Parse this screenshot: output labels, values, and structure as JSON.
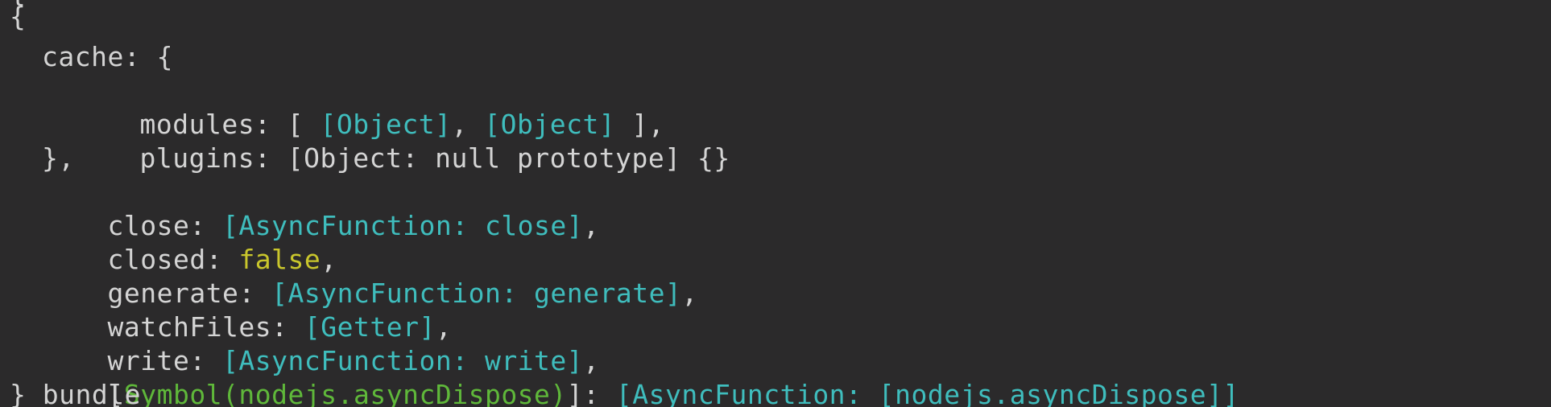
{
  "terminal": {
    "colors": {
      "background": "#2b2a2b",
      "text": "#d4d4d4",
      "special": "#3fbdbd",
      "boolean": "#c9c62c",
      "symbol": "#5fb83a"
    },
    "prev_line_fragment": "{",
    "lines": {
      "open_brace": "{",
      "cache_key": "cache: {",
      "modules_key": "modules: [ ",
      "modules_obj1": "[Object]",
      "modules_sep": ", ",
      "modules_obj2": "[Object]",
      "modules_end": " ],",
      "plugins_key": "plugins: ",
      "plugins_val": "[Object: null prototype] {}",
      "cache_close": "},",
      "close_key": "close: ",
      "close_val": "[AsyncFunction: close]",
      "close_comma": ",",
      "closed_key": "closed: ",
      "closed_val": "false",
      "closed_comma": ",",
      "generate_key": "generate: ",
      "generate_val": "[AsyncFunction: generate]",
      "generate_comma": ",",
      "watchfiles_key": "watchFiles: ",
      "watchfiles_val": "[Getter]",
      "watchfiles_comma": ",",
      "write_key": "write: ",
      "write_val": "[AsyncFunction: write]",
      "write_comma": ",",
      "symbol_open": "[",
      "symbol_val": "Symbol(nodejs.asyncDispose)",
      "symbol_close": "]: ",
      "symbol_fn": "[AsyncFunction: [nodejs.asyncDispose]]",
      "close_brace": "} bundle"
    }
  }
}
